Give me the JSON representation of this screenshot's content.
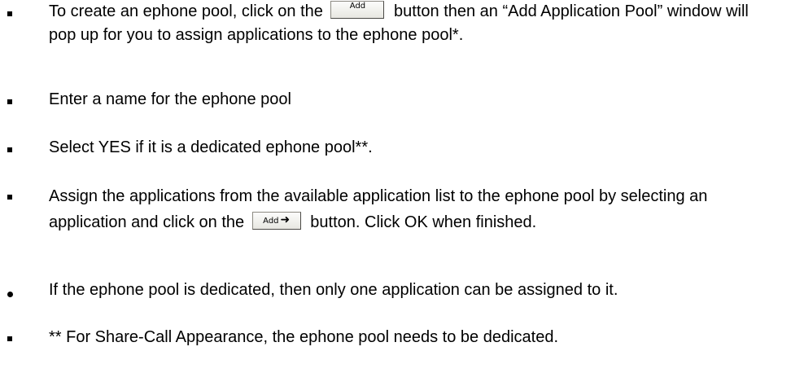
{
  "instructions": {
    "item1": {
      "before": "To create an ephone pool, click on the",
      "button_label": "Add",
      "after": "button then an “Add Application Pool” window will pop up for you to assign applications to the ephone pool*."
    },
    "item2": {
      "text": "Enter a name for the ephone pool"
    },
    "item3": {
      "text": "Select YES if it is a dedicated ephone pool**."
    },
    "item4": {
      "before": "Assign the applications from the available application list to the ephone pool by selecting an application and click on the",
      "button_label": "Add",
      "button_icon": "right-arrow-icon",
      "after": "button. Click OK when finished."
    },
    "note1": {
      "text": "If the ephone pool is dedicated, then only one application can be assigned to it."
    },
    "note2": {
      "text": "** For Share-Call Appearance, the ephone pool needs to be dedicated."
    }
  }
}
